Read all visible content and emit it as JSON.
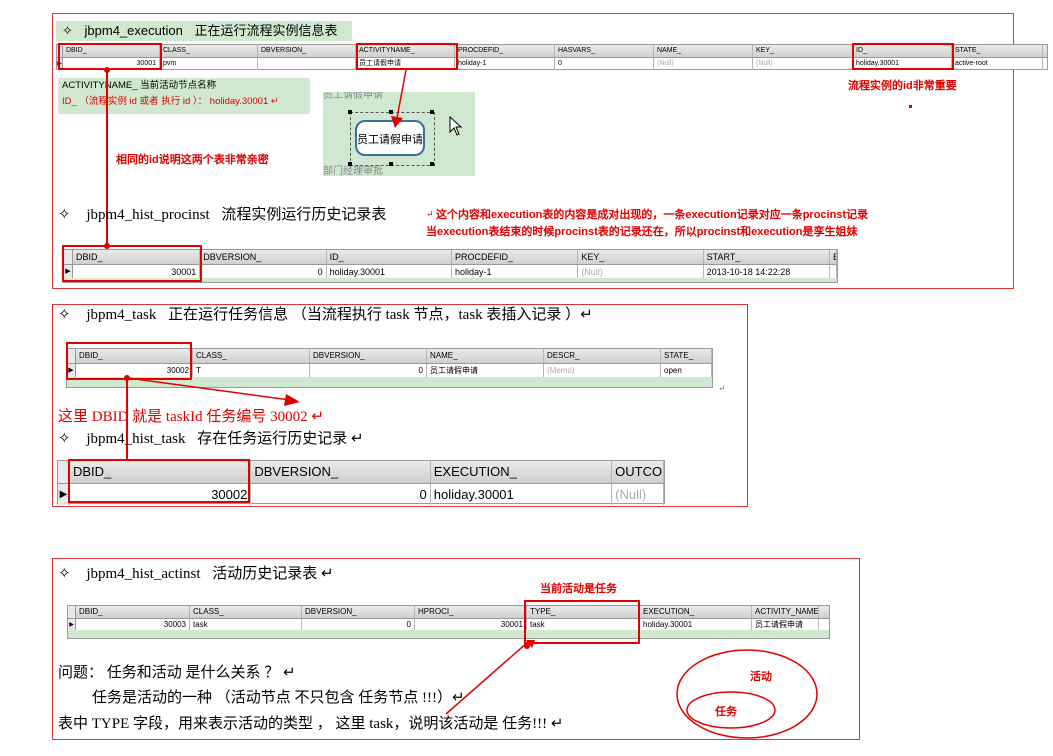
{
  "execution": {
    "diamond": "✧",
    "name": "jbpm4_execution",
    "desc": "正在运行流程实例信息表",
    "columns": [
      "DBID_",
      "CLASS_",
      "DBVERSION_",
      "ACTIVITYNAME_",
      "PROCDEFID_",
      "HASVARS_",
      "NAME_",
      "KEY_",
      "ID_",
      "STATE_"
    ],
    "row": [
      "30001",
      "pvm",
      "",
      "员工请假申请",
      "holiday-1",
      "0",
      "(Null)",
      "(Null)",
      "holiday.30001",
      "active-root"
    ],
    "note_title": "ACTIVITYNAME_  当前活动节点名称",
    "note_id": "ID_ （流程实例 id 或者 执行 id ）：  holiday.30001 ↵",
    "id_important": "流程实例的id非常重要",
    "relation_note": "相同的id说明这两个表非常亲密",
    "node_top": "员工请假申请",
    "node_main": "员工请假申请",
    "node_bottom": "部门经理审批"
  },
  "procinst": {
    "diamond": "✧",
    "name": "jbpm4_hist_procinst",
    "desc": "流程实例运行历史记录表",
    "remark1": "这个内容和execution表的内容是成对出现的，一条execution记录对应一条procinst记录",
    "remark2": "当execution表结束的时候procinst表的记录还在，所以procinst和execution是孪生姐妹",
    "columns": [
      "DBID_",
      "DBVERSION_",
      "ID_",
      "PROCDEFID_",
      "KEY_",
      "START_",
      "E"
    ],
    "row": [
      "30001",
      "0",
      "holiday.30001",
      "holiday-1",
      "(Null)",
      "2013-10-18 14:22:28",
      ""
    ]
  },
  "task": {
    "diamond": "✧",
    "name": "jbpm4_task",
    "desc": "正在运行任务信息 （当流程执行 task 节点，task 表插入记录 ）↵",
    "columns": [
      "DBID_",
      "CLASS_",
      "DBVERSION_",
      "NAME_",
      "DESCR_",
      "STATE_"
    ],
    "row": [
      "30002",
      "T",
      "0",
      "员工请假申请",
      "(Memo)",
      "open"
    ],
    "dbid_note": "这里 DBID  就是  taskId  任务编号  30002 ↵"
  },
  "hist_task": {
    "diamond": "✧",
    "name": "jbpm4_hist_task",
    "desc": "存在任务运行历史记录 ↵",
    "columns": [
      "DBID_",
      "DBVERSION_",
      "EXECUTION_",
      "OUTCOM"
    ],
    "row": [
      "30002",
      "0",
      "holiday.30001",
      "(Null)"
    ]
  },
  "actinst": {
    "diamond": "✧",
    "name": "jbpm4_hist_actinst",
    "desc": "活动历史记录表 ↵",
    "columns": [
      "DBID_",
      "CLASS_",
      "DBVERSION_",
      "HPROCI_",
      "TYPE_",
      "EXECUTION_",
      "ACTIVITY_NAME_"
    ],
    "row": [
      "30003",
      "task",
      "0",
      "30001",
      "task",
      "holiday.30001",
      "员工请假申请"
    ],
    "current_note": "当前活动是任务",
    "q1": "问题：  任务和活动  是什么关系  ？ ↵",
    "q2": "任务是活动的一种  （活动节点  不只包含  任务节点  !!!）↵",
    "q3": "表中 TYPE 字段，用来表示活动的类型 ， 这里 task，说明该活动是  任务!!!  ↵",
    "outer_label": "活动",
    "inner_label": "任务"
  },
  "colors": {
    "red": "#e00000",
    "green": "#cfe8cf",
    "border": "#d33"
  }
}
